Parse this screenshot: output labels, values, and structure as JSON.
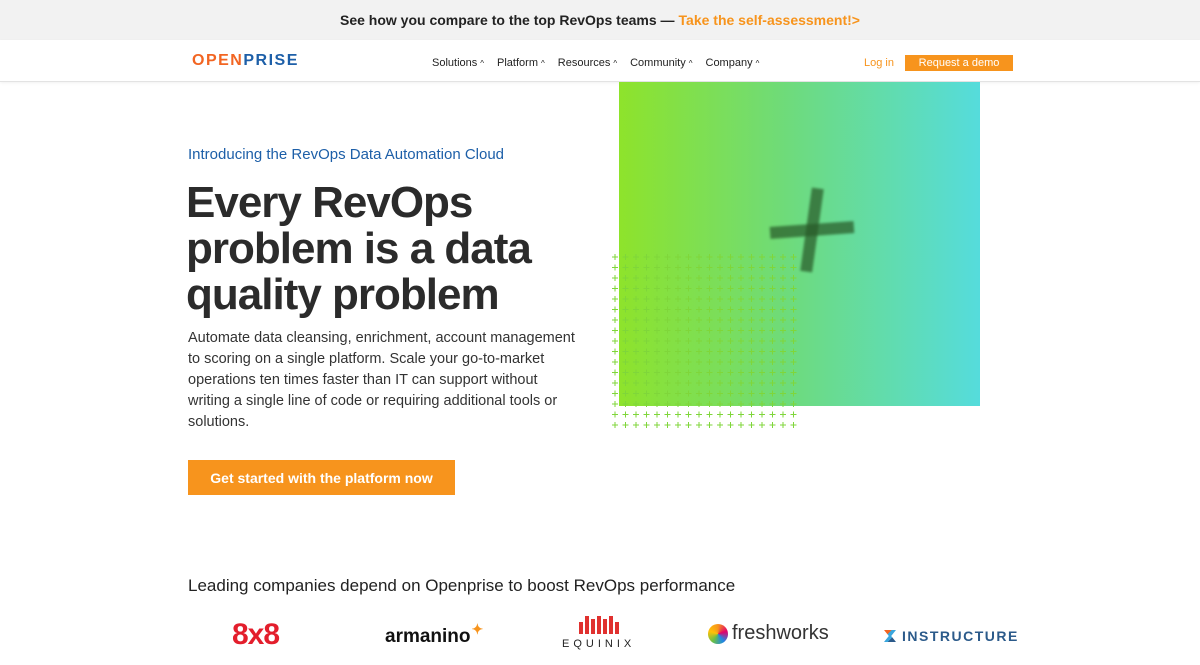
{
  "announcement": {
    "text": "See how you compare to the top RevOps teams —",
    "cta": "Take the self-assessment!>"
  },
  "nav": {
    "logo_open": "OPEN",
    "logo_prise": "PRISE",
    "items": [
      {
        "label": "Solutions"
      },
      {
        "label": "Platform"
      },
      {
        "label": "Resources"
      },
      {
        "label": "Community"
      },
      {
        "label": "Company"
      }
    ],
    "chevron": "^",
    "login": "Log in",
    "demo": "Request a demo"
  },
  "hero": {
    "intro": "Introducing the RevOps Data Automation Cloud",
    "headline": "Every RevOps problem is a data quality problem",
    "body": "Automate data cleansing, enrichment, account management to scoring on a single platform. Scale your go-to-market operations ten times faster than IT can support without writing a single line of code or requiring additional tools or solutions.",
    "cta": "Get started with the platform now"
  },
  "logos": {
    "title": "Leading companies depend on Openprise to boost RevOps performance",
    "eight_by_eight": "8x8",
    "armanino": "armanino",
    "equinix": "EQUINIX",
    "freshworks": "freshworks",
    "instructure": "INSTRUCTURE"
  },
  "colors": {
    "accent": "#f7941d",
    "brand_blue": "#1d5fa8"
  }
}
